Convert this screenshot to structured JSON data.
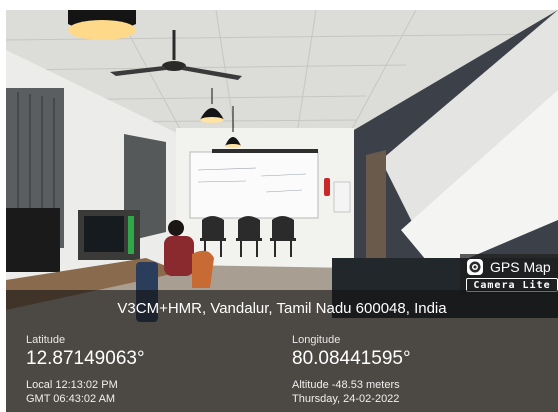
{
  "overlay": {
    "app_name": "GPS Map",
    "app_variant": "Camera Lite",
    "address": "V3CM+HMR, Vandalur, Tamil Nadu 600048, India",
    "latitude_label": "Latitude",
    "latitude_value": "12.87149063°",
    "longitude_label": "Longitude",
    "longitude_value": "80.08441595°",
    "local_time": "Local 12:13:02 PM",
    "gmt_time": "GMT 06:43:02 AM",
    "altitude": "Altitude -48.53 meters",
    "date": "Thursday, 24-02-2022"
  },
  "colors": {
    "panel_bg": "#141414",
    "text": "#ffffff",
    "accent_wall": "#3c4048",
    "wall": "#e9e9e4",
    "floor": "#a99e92"
  },
  "icons": [
    "gps-map-camera-logo-icon"
  ]
}
